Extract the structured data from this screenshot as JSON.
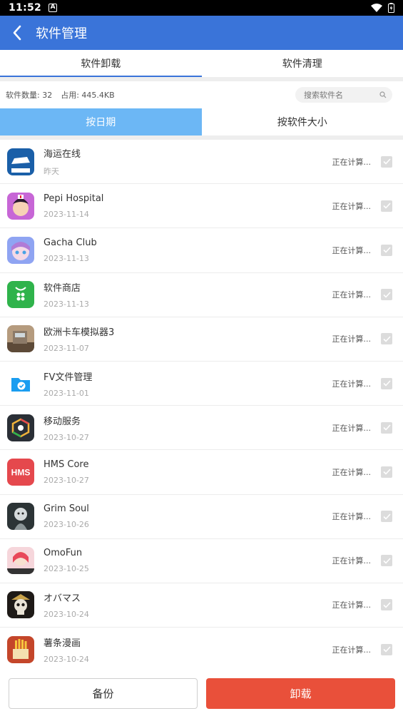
{
  "status_bar": {
    "time": "11:52",
    "notification_icon": "A"
  },
  "header": {
    "title": "软件管理"
  },
  "tabs": [
    {
      "label": "软件卸载",
      "active": true
    },
    {
      "label": "软件清理",
      "active": false
    }
  ],
  "info": {
    "count_text": "软件数量: 32",
    "size_text": "占用: 445.4KB"
  },
  "search": {
    "placeholder": "搜索软件名"
  },
  "sort_tabs": [
    {
      "label": "按日期",
      "active": true
    },
    {
      "label": "按软件大小",
      "active": false
    }
  ],
  "apps": [
    {
      "name": "海运在线",
      "date": "昨天",
      "status": "正在计算...",
      "icon": "ship-icon",
      "color": "#1a5fa8"
    },
    {
      "name": "Pepi Hospital",
      "date": "2023-11-14",
      "status": "正在计算...",
      "icon": "pepi-icon",
      "color": "#e26fc0"
    },
    {
      "name": "Gacha Club",
      "date": "2023-11-13",
      "status": "正在计算...",
      "icon": "gacha-icon",
      "color": "#7f8ee8"
    },
    {
      "name": "软件商店",
      "date": "2023-11-13",
      "status": "正在计算...",
      "icon": "store-icon",
      "color": "#2fb34b"
    },
    {
      "name": "欧洲卡车模拟器3",
      "date": "2023-11-07",
      "status": "正在计算...",
      "icon": "truck-icon",
      "color": "#8a6f55"
    },
    {
      "name": "FV文件管理",
      "date": "2023-11-01",
      "status": "正在计算...",
      "icon": "folder-icon",
      "color": "#1a9df0"
    },
    {
      "name": "移动服务",
      "date": "2023-10-27",
      "status": "正在计算...",
      "icon": "service-icon",
      "color": "#2a2f36"
    },
    {
      "name": "HMS Core",
      "date": "2023-10-27",
      "status": "正在计算...",
      "icon": "hms-icon",
      "color": "#e5484d"
    },
    {
      "name": "Grim Soul",
      "date": "2023-10-26",
      "status": "正在计算...",
      "icon": "grim-icon",
      "color": "#3b4a4c"
    },
    {
      "name": "OmoFun",
      "date": "2023-10-25",
      "status": "正在计算...",
      "icon": "omofun-icon",
      "color": "#f1b8c0"
    },
    {
      "name": "オバマス",
      "date": "2023-10-24",
      "status": "正在计算...",
      "icon": "skull-icon",
      "color": "#1e1a17"
    },
    {
      "name": "薯条漫画",
      "date": "2023-10-24",
      "status": "正在计算...",
      "icon": "fries-icon",
      "color": "#c4462a"
    }
  ],
  "buttons": {
    "backup": "备份",
    "uninstall": "卸载"
  },
  "colors": {
    "primary": "#3a74d9",
    "sort_active": "#6cb7f5",
    "danger": "#e9503a"
  }
}
